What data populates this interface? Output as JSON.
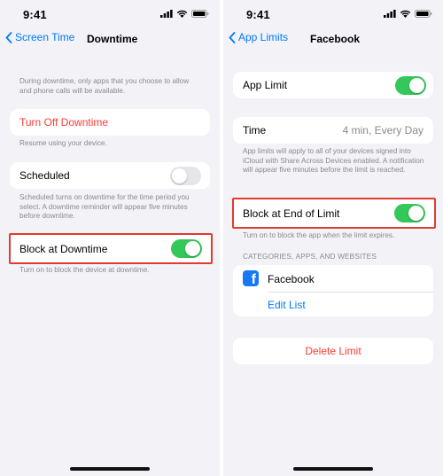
{
  "left": {
    "status_time": "9:41",
    "back_label": "Screen Time",
    "title": "Downtime",
    "intro_note": "During downtime, only apps that you choose to allow and phone calls will be available.",
    "turn_off_label": "Turn Off Downtime",
    "turn_off_note": "Resume using your device.",
    "scheduled_label": "Scheduled",
    "scheduled_on": false,
    "scheduled_note": "Scheduled turns on downtime for the time period you select. A downtime reminder will appear five minutes before downtime.",
    "block_label": "Block at Downtime",
    "block_on": true,
    "block_note": "Turn on to block the device at downtime."
  },
  "right": {
    "status_time": "9:41",
    "back_label": "App Limits",
    "title": "Facebook",
    "app_limit_label": "App Limit",
    "app_limit_on": true,
    "time_label": "Time",
    "time_value": "4 min, Every Day",
    "time_note": "App limits will apply to all of your devices signed into iCloud with Share Across Devices enabled. A notification will appear five minutes before the limit is reached.",
    "block_label": "Block at End of Limit",
    "block_on": true,
    "block_note": "Turn on to block the app when the limit expires.",
    "section_header": "CATEGORIES, APPS, AND WEBSITES",
    "app_name": "Facebook",
    "app_icon": "facebook-icon",
    "edit_list_label": "Edit List",
    "delete_label": "Delete Limit"
  },
  "colors": {
    "accent_blue": "#007aff",
    "toggle_green": "#34c759",
    "destructive_red": "#ff3b30",
    "highlight_red": "#e23a2e"
  }
}
